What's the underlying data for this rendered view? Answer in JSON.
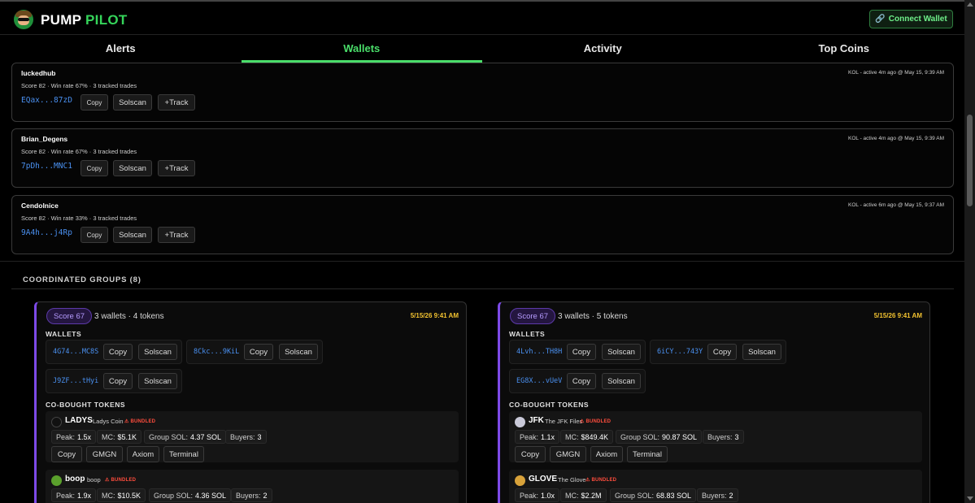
{
  "app": {
    "brand_part1": "PUMP",
    "brand_part2": "PILOT",
    "connect_label": "Connect Wallet",
    "accent_color": "#4ade6a"
  },
  "tabs": [
    {
      "label": "Alerts",
      "active": false
    },
    {
      "label": "Wallets",
      "active": true
    },
    {
      "label": "Activity",
      "active": false
    },
    {
      "label": "Top Coins",
      "active": false
    }
  ],
  "wallets": [
    {
      "name": "luckedhub",
      "stats": "Score 82 · Win rate 67% · 3 tracked trades",
      "meta": "KOL - active 4m ago @ May 15, 9:39 AM",
      "address": "EQax...87zD",
      "copy": "Copy",
      "solscan": "Solscan",
      "track": "+Track"
    },
    {
      "name": "Brian_Degens",
      "stats": "Score 82 · Win rate 67% · 3 tracked trades",
      "meta": "KOL - active 4m ago @ May 15, 9:39 AM",
      "address": "7pDh...MNC1",
      "copy": "Copy",
      "solscan": "Solscan",
      "track": "+Track"
    },
    {
      "name": "Cendolnice",
      "stats": "Score 82 · Win rate 33% · 3 tracked trades",
      "meta": "KOL - active 6m ago @ May 15, 9:37 AM",
      "address": "9A4h...j4Rp",
      "copy": "Copy",
      "solscan": "Solscan",
      "track": "+Track"
    }
  ],
  "coordinated": {
    "title": "COORDINATED GROUPS (8)",
    "groups": [
      {
        "score": "Score 67",
        "summary": "3 wallets · 4 tokens",
        "time": "5/15/26 9:41 AM",
        "wallets_label": "WALLETS",
        "wallets": [
          {
            "address": "4G74...MC8S",
            "copy": "Copy",
            "solscan": "Solscan"
          },
          {
            "address": "8Ckc...9KiL",
            "copy": "Copy",
            "solscan": "Solscan"
          },
          {
            "address": "J9ZF...tHyi",
            "copy": "Copy",
            "solscan": "Solscan"
          }
        ],
        "tokens_label": "CO-BOUGHT TOKENS",
        "tokens": [
          {
            "symbol": "LADYS",
            "name": "Ladys Coin",
            "bundled": "⚠ BUNDLED",
            "peak_label": "Peak:",
            "peak": "1.5x",
            "mc_label": "MC:",
            "mc": "$5.1K",
            "sol_label": "Group SOL:",
            "sol": "4.37 SOL",
            "buyers_label": "Buyers:",
            "buyers": "3",
            "actions": [
              "Copy",
              "GMGN",
              "Axiom",
              "Terminal"
            ],
            "icon_color": "#111111"
          },
          {
            "symbol": "boop",
            "name": "boop",
            "bundled": "⚠ BUNDLED",
            "peak_label": "Peak:",
            "peak": "1.9x",
            "mc_label": "MC:",
            "mc": "$10.5K",
            "sol_label": "Group SOL:",
            "sol": "4.36 SOL",
            "buyers_label": "Buyers:",
            "buyers": "2",
            "icon_color": "#5aa02c"
          }
        ]
      },
      {
        "score": "Score 67",
        "summary": "3 wallets · 5 tokens",
        "time": "5/15/26 9:41 AM",
        "wallets_label": "WALLETS",
        "wallets": [
          {
            "address": "4Lvh...TH8H",
            "copy": "Copy",
            "solscan": "Solscan"
          },
          {
            "address": "6iCY...743Y",
            "copy": "Copy",
            "solscan": "Solscan"
          },
          {
            "address": "EG8X...vUeV",
            "copy": "Copy",
            "solscan": "Solscan"
          }
        ],
        "tokens_label": "CO-BOUGHT TOKENS",
        "tokens": [
          {
            "symbol": "JFK",
            "name": "The JFK Files",
            "bundled": "⚠ BUNDLED",
            "peak_label": "Peak:",
            "peak": "1.1x",
            "mc_label": "MC:",
            "mc": "$849.4K",
            "sol_label": "Group SOL:",
            "sol": "90.87 SOL",
            "buyers_label": "Buyers:",
            "buyers": "3",
            "actions": [
              "Copy",
              "GMGN",
              "Axiom",
              "Terminal"
            ],
            "icon_color": "#c9c9d8"
          },
          {
            "symbol": "GLOVE",
            "name": "The Glove",
            "bundled": "⚠ BUNDLED",
            "peak_label": "Peak:",
            "peak": "1.0x",
            "mc_label": "MC:",
            "mc": "$2.2M",
            "sol_label": "Group SOL:",
            "sol": "68.83 SOL",
            "buyers_label": "Buyers:",
            "buyers": "2",
            "icon_color": "#d8a23a"
          }
        ]
      }
    ]
  }
}
